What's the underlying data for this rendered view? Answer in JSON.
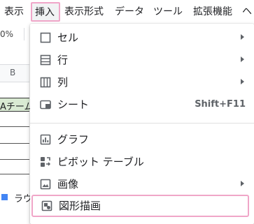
{
  "menubar": {
    "items": [
      "表示",
      "挿入",
      "表示形式",
      "データ",
      "ツール",
      "拡張機能",
      "ヘ"
    ],
    "active": "挿入"
  },
  "toolbar": {
    "zoom": "0%"
  },
  "sheet": {
    "column_header": "B",
    "cell_text": "Aチーム",
    "legend_label": "ラウ",
    "legend_color": "#4285f4",
    "header_fill": "#d9ead3"
  },
  "insert_menu": {
    "items": [
      {
        "label": "セル",
        "icon": "cell-icon",
        "submenu": true
      },
      {
        "label": "行",
        "icon": "rows-icon",
        "submenu": true
      },
      {
        "label": "列",
        "icon": "columns-icon",
        "submenu": true
      },
      {
        "label": "シート",
        "icon": "sheet-icon",
        "shortcut": "Shift+F11"
      },
      {
        "label": "グラフ",
        "icon": "chart-icon"
      },
      {
        "label": "ピボット テーブル",
        "icon": "pivot-table-icon"
      },
      {
        "label": "画像",
        "icon": "image-icon",
        "submenu": true
      },
      {
        "label": "図形描画",
        "icon": "drawing-icon",
        "highlighted": true
      }
    ],
    "highlight_color": "#f0a6c8"
  }
}
